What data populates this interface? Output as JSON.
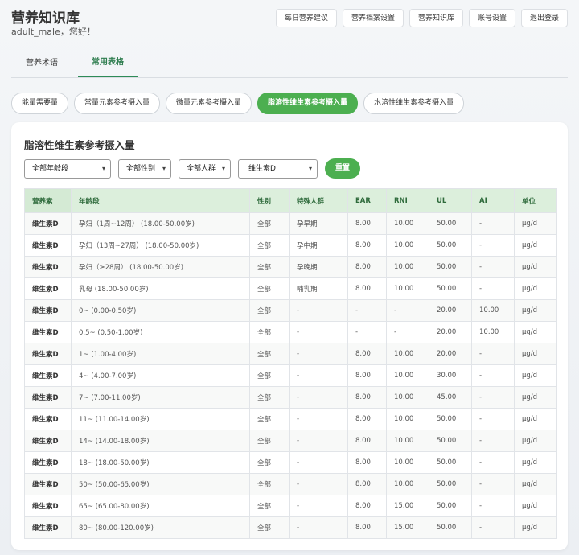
{
  "app": {
    "title": "营养知识库",
    "greeting": "adult_male，您好！"
  },
  "topnav": [
    "每日营养建议",
    "营养档案设置",
    "营养知识库",
    "账号设置",
    "退出登录"
  ],
  "tabs": [
    "营养术语",
    "常用表格"
  ],
  "active_tab": "常用表格",
  "pills": [
    "能量需要量",
    "常量元素参考摄入量",
    "微量元素参考摄入量",
    "脂溶性维生素参考摄入量",
    "水溶性维生素参考摄入量"
  ],
  "active_pill": "脂溶性维生素参考摄入量",
  "card": {
    "title": "脂溶性维生素参考摄入量"
  },
  "filters": {
    "age": "全部年龄段",
    "sex": "全部性别",
    "group": "全部人群",
    "nutrient": "维生素D",
    "reset_label": "重置"
  },
  "table": {
    "headers": [
      "营养素",
      "年龄段",
      "性别",
      "特殊人群",
      "EAR",
      "RNI",
      "UL",
      "AI",
      "单位"
    ],
    "rows": [
      [
        "维生素D",
        "孕妇（1周~12周） (18.00-50.00岁)",
        "全部",
        "孕早期",
        "8.00",
        "10.00",
        "50.00",
        "-",
        "μg/d"
      ],
      [
        "维生素D",
        "孕妇（13周~27周） (18.00-50.00岁)",
        "全部",
        "孕中期",
        "8.00",
        "10.00",
        "50.00",
        "-",
        "μg/d"
      ],
      [
        "维生素D",
        "孕妇（≥28周） (18.00-50.00岁)",
        "全部",
        "孕晚期",
        "8.00",
        "10.00",
        "50.00",
        "-",
        "μg/d"
      ],
      [
        "维生素D",
        "乳母 (18.00-50.00岁)",
        "全部",
        "哺乳期",
        "8.00",
        "10.00",
        "50.00",
        "-",
        "μg/d"
      ],
      [
        "维生素D",
        "0~ (0.00-0.50岁)",
        "全部",
        "-",
        "-",
        "-",
        "20.00",
        "10.00",
        "μg/d"
      ],
      [
        "维生素D",
        "0.5~ (0.50-1.00岁)",
        "全部",
        "-",
        "-",
        "-",
        "20.00",
        "10.00",
        "μg/d"
      ],
      [
        "维生素D",
        "1~ (1.00-4.00岁)",
        "全部",
        "-",
        "8.00",
        "10.00",
        "20.00",
        "-",
        "μg/d"
      ],
      [
        "维生素D",
        "4~ (4.00-7.00岁)",
        "全部",
        "-",
        "8.00",
        "10.00",
        "30.00",
        "-",
        "μg/d"
      ],
      [
        "维生素D",
        "7~ (7.00-11.00岁)",
        "全部",
        "-",
        "8.00",
        "10.00",
        "45.00",
        "-",
        "μg/d"
      ],
      [
        "维生素D",
        "11~ (11.00-14.00岁)",
        "全部",
        "-",
        "8.00",
        "10.00",
        "50.00",
        "-",
        "μg/d"
      ],
      [
        "维生素D",
        "14~ (14.00-18.00岁)",
        "全部",
        "-",
        "8.00",
        "10.00",
        "50.00",
        "-",
        "μg/d"
      ],
      [
        "维生素D",
        "18~ (18.00-50.00岁)",
        "全部",
        "-",
        "8.00",
        "10.00",
        "50.00",
        "-",
        "μg/d"
      ],
      [
        "维生素D",
        "50~ (50.00-65.00岁)",
        "全部",
        "-",
        "8.00",
        "10.00",
        "50.00",
        "-",
        "μg/d"
      ],
      [
        "维生素D",
        "65~ (65.00-80.00岁)",
        "全部",
        "-",
        "8.00",
        "15.00",
        "50.00",
        "-",
        "μg/d"
      ],
      [
        "维生素D",
        "80~ (80.00-120.00岁)",
        "全部",
        "-",
        "8.00",
        "15.00",
        "50.00",
        "-",
        "μg/d"
      ]
    ]
  }
}
